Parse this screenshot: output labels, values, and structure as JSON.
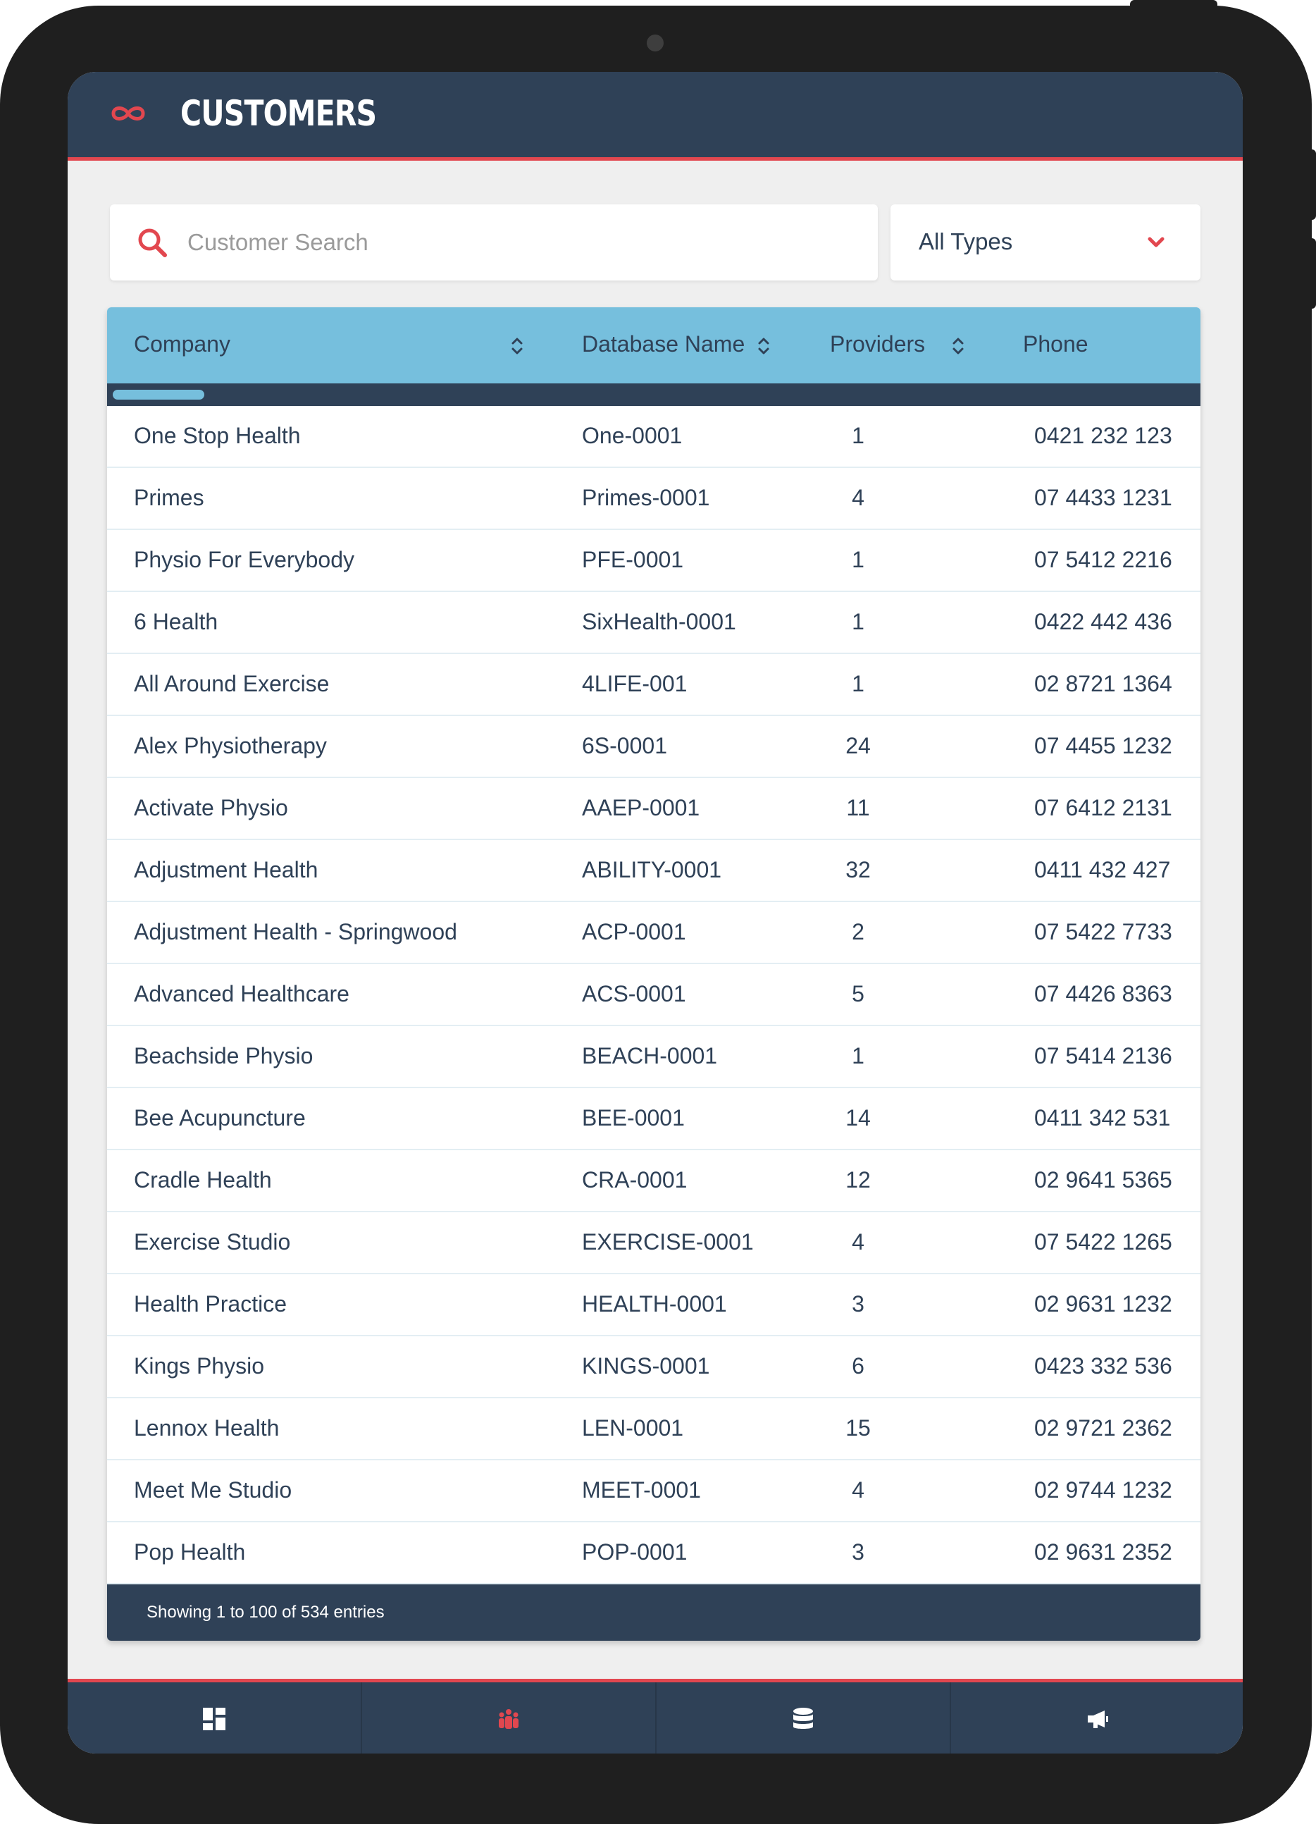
{
  "header": {
    "title": "CUSTOMERS",
    "logo": "infinity-icon",
    "accent_color": "#e2474f"
  },
  "search": {
    "placeholder": "Customer Search",
    "value": ""
  },
  "type_filter": {
    "selected": "All Types"
  },
  "table": {
    "columns": [
      "Company",
      "Database Name",
      "Providers",
      "Phone"
    ],
    "rows": [
      [
        "One Stop Health",
        "One-0001",
        "1",
        "0421 232 123"
      ],
      [
        "Primes",
        "Primes-0001",
        "4",
        "07 4433 1231"
      ],
      [
        "Physio For Everybody",
        "PFE-0001",
        "1",
        "07 5412 2216"
      ],
      [
        "6 Health",
        "SixHealth-0001",
        "1",
        "0422 442 436"
      ],
      [
        "All Around Exercise",
        "4LIFE-001",
        "1",
        "02 8721 1364"
      ],
      [
        "Alex Physiotherapy",
        "6S-0001",
        "24",
        "07 4455 1232"
      ],
      [
        "Activate Physio",
        "AAEP-0001",
        "11",
        "07 6412 2131"
      ],
      [
        "Adjustment Health",
        "ABILITY-0001",
        "32",
        "0411 432 427"
      ],
      [
        "Adjustment Health - Springwood",
        "ACP-0001",
        "2",
        "07 5422 7733"
      ],
      [
        "Advanced Healthcare",
        "ACS-0001",
        "5",
        "07 4426 8363"
      ],
      [
        "Beachside Physio",
        "BEACH-0001",
        "1",
        "07 5414 2136"
      ],
      [
        "Bee Acupuncture",
        "BEE-0001",
        "14",
        "0411 342 531"
      ],
      [
        "Cradle Health",
        "CRA-0001",
        "12",
        "02 9641 5365"
      ],
      [
        "Exercise Studio",
        "EXERCISE-0001",
        "4",
        "07 5422 1265"
      ],
      [
        "Health Practice",
        "HEALTH-0001",
        "3",
        "02 9631 1232"
      ],
      [
        "Kings Physio",
        "KINGS-0001",
        "6",
        "0423 332 536"
      ],
      [
        "Lennox Health",
        "LEN-0001",
        "15",
        "02 9721 2362"
      ],
      [
        "Meet Me Studio",
        "MEET-0001",
        "4",
        "02 9744 1232"
      ],
      [
        "Pop Health",
        "POP-0001",
        "3",
        "02 9631 2352"
      ]
    ],
    "footer_text": "Showing 1 to 100 of 534 entries"
  },
  "bottom_nav": {
    "items": [
      {
        "icon": "dashboard-icon",
        "active": false
      },
      {
        "icon": "customers-icon",
        "active": true
      },
      {
        "icon": "database-icon",
        "active": false
      },
      {
        "icon": "megaphone-icon",
        "active": false
      }
    ]
  }
}
